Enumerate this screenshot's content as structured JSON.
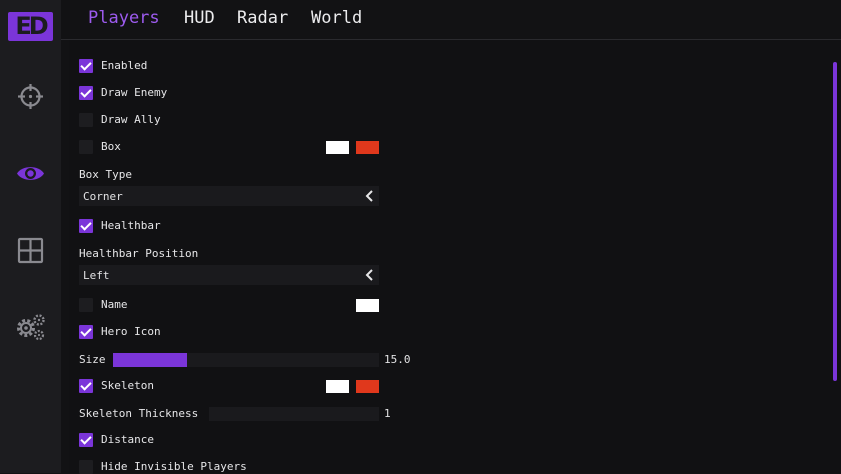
{
  "sidebar": {
    "logo": "ED",
    "items": [
      {
        "icon": "crosshair-icon"
      },
      {
        "icon": "eye-icon",
        "active": true
      },
      {
        "icon": "grid-icon"
      },
      {
        "icon": "gears-icon"
      }
    ]
  },
  "tabs": [
    {
      "label": "Players",
      "active": true
    },
    {
      "label": "HUD"
    },
    {
      "label": "Radar"
    },
    {
      "label": "World"
    }
  ],
  "options": {
    "enabled": {
      "label": "Enabled",
      "checked": true
    },
    "draw_enemy": {
      "label": "Draw Enemy",
      "checked": true
    },
    "draw_ally": {
      "label": "Draw Ally",
      "checked": false
    },
    "box": {
      "label": "Box",
      "checked": false,
      "colors": [
        "#ffffff",
        "#e0381c"
      ]
    },
    "box_type": {
      "label": "Box Type",
      "value": "Corner"
    },
    "healthbar": {
      "label": "Healthbar",
      "checked": true
    },
    "healthbar_position": {
      "label": "Healthbar Position",
      "value": "Left"
    },
    "name": {
      "label": "Name",
      "checked": false,
      "colors": [
        "#ffffff"
      ]
    },
    "hero_icon": {
      "label": "Hero Icon",
      "checked": true
    },
    "size": {
      "label": "Size",
      "value": "15.0",
      "fill_fraction": 0.28
    },
    "skeleton": {
      "label": "Skeleton",
      "checked": true,
      "colors": [
        "#ffffff",
        "#e0381c"
      ]
    },
    "skeleton_thickness": {
      "label": "Skeleton Thickness",
      "value": "1",
      "fill_fraction": 0
    },
    "distance": {
      "label": "Distance",
      "checked": true
    },
    "hide_invisible": {
      "label": "Hide Invisible Players",
      "checked": false
    }
  },
  "colors": {
    "accent": "#7b35d9",
    "accent_text": "#9d5bef",
    "sidebar": "#1c1c1f",
    "background": "#121214"
  }
}
